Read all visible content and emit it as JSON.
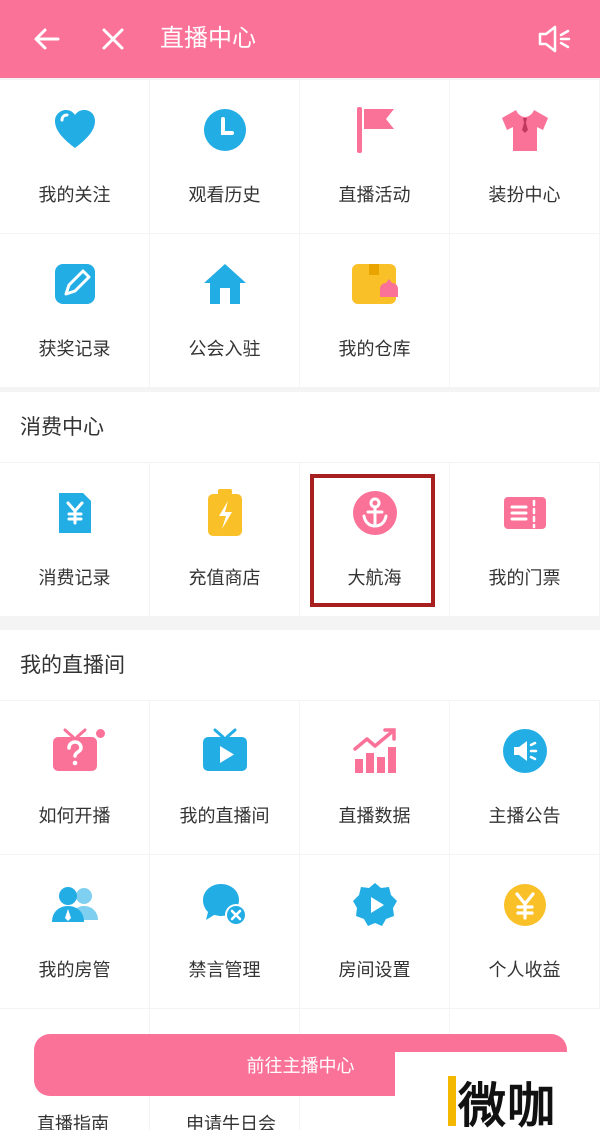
{
  "header": {
    "title": "直播中心"
  },
  "main_grid": [
    {
      "label": "我的关注",
      "icon": "heart-icon"
    },
    {
      "label": "观看历史",
      "icon": "clock-icon"
    },
    {
      "label": "直播活动",
      "icon": "flag-icon"
    },
    {
      "label": "装扮中心",
      "icon": "shirt-icon"
    },
    {
      "label": "获奖记录",
      "icon": "edit-note-icon"
    },
    {
      "label": "公会入驻",
      "icon": "house-icon"
    },
    {
      "label": "我的仓库",
      "icon": "box-icon"
    }
  ],
  "consumption": {
    "title": "消费中心",
    "items": [
      {
        "label": "消费记录",
        "icon": "yen-receipt-icon"
      },
      {
        "label": "充值商店",
        "icon": "battery-charge-icon"
      },
      {
        "label": "大航海",
        "icon": "anchor-icon"
      },
      {
        "label": "我的门票",
        "icon": "ticket-icon"
      }
    ]
  },
  "my_room": {
    "title": "我的直播间",
    "items": [
      {
        "label": "如何开播",
        "icon": "tv-question-icon"
      },
      {
        "label": "我的直播间",
        "icon": "tv-play-icon"
      },
      {
        "label": "直播数据",
        "icon": "bar-chart-icon"
      },
      {
        "label": "主播公告",
        "icon": "speaker-icon"
      },
      {
        "label": "我的房管",
        "icon": "users-icon"
      },
      {
        "label": "禁言管理",
        "icon": "mute-chat-icon"
      },
      {
        "label": "房间设置",
        "icon": "settings-play-icon"
      },
      {
        "label": "个人收益",
        "icon": "yen-coin-icon"
      }
    ]
  },
  "cta": {
    "label": "前往主播中心"
  },
  "peek": {
    "left": "直播指南",
    "right": "申请牛日会"
  },
  "watermark": {
    "text": "微咖"
  },
  "colors": {
    "brand_pink": "#fb7299",
    "icon_blue": "#23ade5",
    "icon_yellow": "#f9c028",
    "highlight": "#a71f1f"
  }
}
